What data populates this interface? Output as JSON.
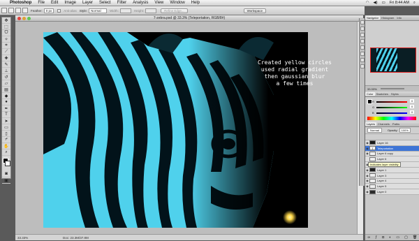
{
  "menubar": {
    "apple": "",
    "app_name": "Photoshop",
    "menus": [
      "File",
      "Edit",
      "Image",
      "Layer",
      "Select",
      "Filter",
      "Analysis",
      "View",
      "Window",
      "Help"
    ],
    "clock": "Fri 8:44 AM"
  },
  "options_bar": {
    "feather_label": "Feather:",
    "feather_value": "0 px",
    "antialias_label": "Anti-alias",
    "style_label": "Style:",
    "style_value": "Normal",
    "width_label": "Width:",
    "height_label": "Height:",
    "refine_button": "Refine Edge...",
    "workspace_button": "Workspace"
  },
  "document": {
    "title": "7-zebra.psd @ 33.3% (Teleportation, RGB/8#)",
    "zoom": "33.33%",
    "doc_size": "Doc: 23.3M/37.8M"
  },
  "canvas": {
    "annotation": [
      "Created yellow circles",
      "used radial gradient",
      "then gaussian blur",
      "a few times"
    ],
    "colors": {
      "background": "#000000",
      "stripe_light": "#58dcf4",
      "stripe_dark": "#031219",
      "glow": "#ffd84a"
    }
  },
  "panels": {
    "navigator_tabs": [
      "Navigator",
      "Histogram",
      "Info"
    ],
    "nav_zoom": "33.33%",
    "color_tabs": [
      "Color",
      "Swatches",
      "Styles"
    ],
    "color_sliders": [
      {
        "channel": "R",
        "value": "0"
      },
      {
        "channel": "G",
        "value": "0"
      },
      {
        "channel": "B",
        "value": "0"
      }
    ],
    "layers_tabs": [
      "Layers",
      "Channels",
      "Paths"
    ],
    "blend_mode": "Normal",
    "opacity_label": "Opacity:",
    "opacity_value": "100%",
    "layers": [
      {
        "name": "Layer 16",
        "selected": false,
        "thumb": "#1a1a1a"
      },
      {
        "name": "Teleportation",
        "selected": true,
        "thumb": "#ffffff"
      },
      {
        "name": "Layer 6 copy",
        "selected": false,
        "thumb": "#eeeeee"
      },
      {
        "name": "Layer 6",
        "selected": false,
        "thumb": "#eeeeee"
      },
      {
        "name": "Layer 2",
        "selected": false,
        "thumb": "#5ad7ef"
      },
      {
        "name": "Layer 1",
        "selected": false,
        "thumb": "#1c1c1c"
      },
      {
        "name": "Layer 3",
        "selected": false,
        "thumb": "#eeeeee"
      },
      {
        "name": "Layer 4",
        "selected": false,
        "thumb": "#eeeeee"
      },
      {
        "name": "Layer 5",
        "selected": false,
        "thumb": "#eeeeee"
      },
      {
        "name": "Layer 0",
        "selected": false,
        "thumb": "#2a2a2a"
      }
    ],
    "tooltip": "Indicates layer visibility"
  }
}
